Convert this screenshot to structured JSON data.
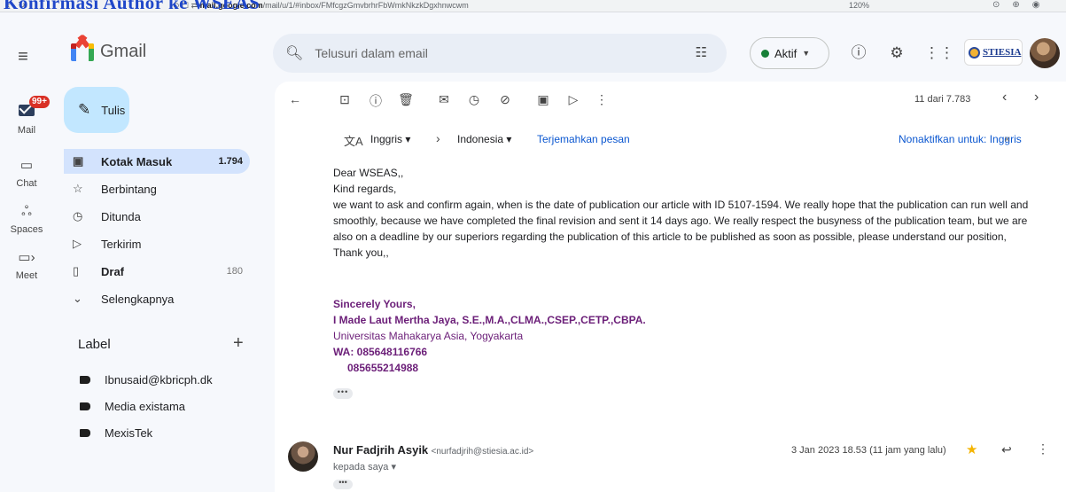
{
  "browser": {
    "overlay_title": "Konfirmasi Author ke WSEAS",
    "url_domain": "mail.google.com",
    "url_rest": "/mail/u/1/#inbox/FMfcgzGmvbrhrFbWmkNkzkDgxhnwcwm",
    "zoom": "120%"
  },
  "rail": {
    "mail_badge": "99+",
    "mail_label": "Mail",
    "chat_label": "Chat",
    "spaces_label": "Spaces",
    "meet_label": "Meet"
  },
  "logo": {
    "text": "Gmail"
  },
  "compose": {
    "label": "Tulis"
  },
  "nav": [
    {
      "label": "Kotak Masuk",
      "count": "1.794",
      "icon": "inbox-icon"
    },
    {
      "label": "Berbintang",
      "count": "",
      "icon": "star-icon"
    },
    {
      "label": "Ditunda",
      "count": "",
      "icon": "clock-icon"
    },
    {
      "label": "Terkirim",
      "count": "",
      "icon": "send-icon"
    },
    {
      "label": "Draf",
      "count": "180",
      "icon": "draft-icon"
    },
    {
      "label": "Selengkapnya",
      "count": "",
      "icon": "chevron-down-icon"
    }
  ],
  "labels": {
    "heading": "Label",
    "items": [
      "Ibnusaid@kbricph.dk",
      "Media existama",
      "MexisTek"
    ]
  },
  "search": {
    "placeholder": "Telusuri dalam email"
  },
  "status": {
    "label": "Aktif",
    "color": "#188038"
  },
  "org": {
    "name": "STIESIA"
  },
  "pager": {
    "text": "11 dari 7.783"
  },
  "translate": {
    "from": "Inggris",
    "to": "Indonesia",
    "action": "Terjemahkan pesan",
    "disable": "Nonaktifkan untuk: Inggris"
  },
  "email": {
    "greeting": "Dear WSEAS,,",
    "regards": "Kind regards,",
    "paragraph": "we want to ask and confirm again, when is the date of publication our article with ID 5107-1594. We really hope that the publication can run well and smoothly, because we have completed the final revision and sent it 14 days ago. We really respect the busyness of the publication team, but we are also on a deadline by our superiors regarding the publication of this article to be published as soon as possible, please understand our position,",
    "thanks": "Thank you,,",
    "signature": {
      "closing": "Sincerely Yours,",
      "name": "I Made Laut Mertha Jaya, S.E.,M.A.,CLMA.,CSEP.,CETP.,CBPA.",
      "affiliation": "Universitas Mahakarya Asia, Yogyakarta",
      "wa": "WA: 085648116766",
      "wa2": "085655214988",
      "color": "#6b1e78"
    }
  },
  "reply": {
    "sender_name": "Nur Fadjrih Asyik",
    "sender_email": "<nurfadjrih@stiesia.ac.id>",
    "to": "kepada saya",
    "date": "3 Jan 2023 18.53 (11 jam yang lalu)"
  }
}
